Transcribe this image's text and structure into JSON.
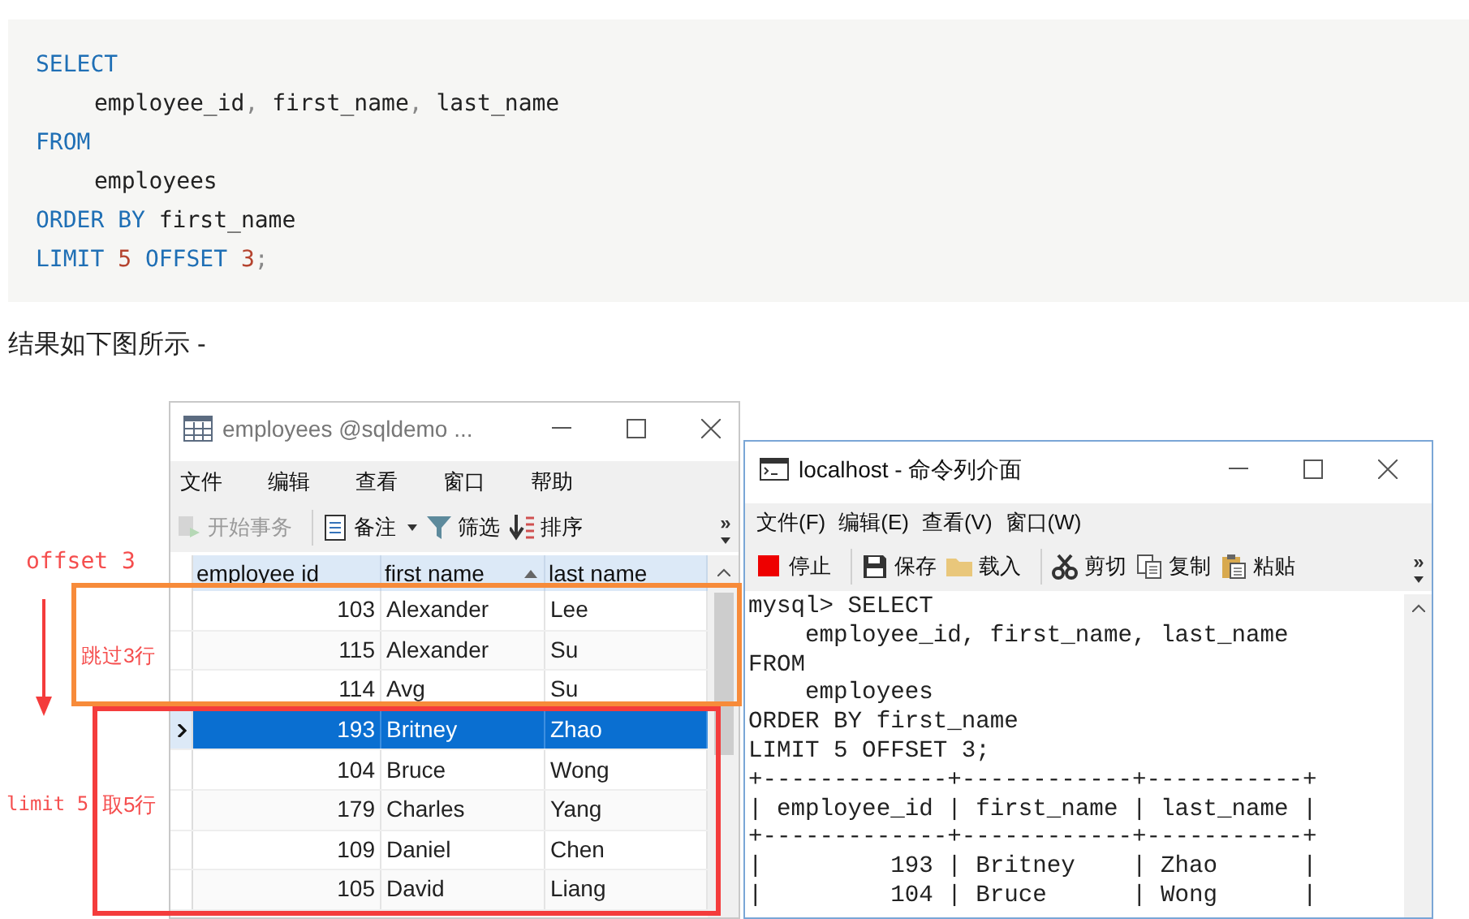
{
  "code_block": {
    "lines": [
      {
        "indent": false,
        "tokens": [
          {
            "text": "SELECT",
            "kind": "keyword"
          }
        ]
      },
      {
        "indent": true,
        "tokens": [
          {
            "text": "employee_id",
            "kind": "plain"
          },
          {
            "text": ",",
            "kind": "punct"
          },
          {
            "text": " first_name",
            "kind": "plain"
          },
          {
            "text": ",",
            "kind": "punct"
          },
          {
            "text": " last_name",
            "kind": "plain"
          }
        ]
      },
      {
        "indent": false,
        "tokens": [
          {
            "text": "FROM",
            "kind": "keyword"
          }
        ]
      },
      {
        "indent": true,
        "tokens": [
          {
            "text": "employees",
            "kind": "plain"
          }
        ]
      },
      {
        "indent": false,
        "tokens": [
          {
            "text": "ORDER BY",
            "kind": "keyword"
          },
          {
            "text": " first_name",
            "kind": "plain"
          }
        ]
      },
      {
        "indent": false,
        "tokens": [
          {
            "text": "LIMIT",
            "kind": "keyword"
          },
          {
            "text": " 5 ",
            "kind": "number"
          },
          {
            "text": "OFFSET",
            "kind": "keyword"
          },
          {
            "text": " 3",
            "kind": "number"
          },
          {
            "text": ";",
            "kind": "punct"
          }
        ]
      }
    ]
  },
  "caption": "结果如下图所示 -",
  "grid_window": {
    "title": "employees @sqldemo ...",
    "menu": [
      "文件",
      "编辑",
      "查看",
      "窗口",
      "帮助"
    ],
    "toolbar": [
      {
        "label": "开始事务",
        "disabled": true
      },
      {
        "label": "备注",
        "disabled": false
      },
      {
        "label": "筛选",
        "disabled": false
      },
      {
        "label": "排序",
        "disabled": false
      }
    ],
    "more": "»",
    "columns": [
      {
        "label": "employee id",
        "sorted": false
      },
      {
        "label": "first name",
        "sorted": true
      },
      {
        "label": "last name",
        "sorted": false
      }
    ],
    "rows": [
      {
        "cells": [
          "103",
          "Alexander",
          "Lee"
        ],
        "selected": false
      },
      {
        "cells": [
          "115",
          "Alexander",
          "Su"
        ],
        "selected": false
      },
      {
        "cells": [
          "114",
          "Avg",
          "Su"
        ],
        "selected": false
      },
      {
        "cells": [
          "193",
          "Britney",
          "Zhao"
        ],
        "selected": true
      },
      {
        "cells": [
          "104",
          "Bruce",
          "Wong"
        ],
        "selected": false
      },
      {
        "cells": [
          "179",
          "Charles",
          "Yang"
        ],
        "selected": false
      },
      {
        "cells": [
          "109",
          "Daniel",
          "Chen"
        ],
        "selected": false
      },
      {
        "cells": [
          "105",
          "David",
          "Liang"
        ],
        "selected": false
      }
    ]
  },
  "console_window": {
    "title": "localhost - 命令列介面",
    "menu": [
      "文件(F)",
      "编辑(E)",
      "查看(V)",
      "窗口(W)"
    ],
    "toolbar": [
      {
        "label": "停止"
      },
      {
        "label": "保存"
      },
      {
        "label": "载入"
      },
      {
        "label": "剪切"
      },
      {
        "label": "复制"
      },
      {
        "label": "粘贴"
      }
    ],
    "more": "»",
    "lines": [
      "mysql> SELECT",
      "    employee_id, first_name, last_name",
      "FROM",
      "    employees",
      "ORDER BY first_name",
      "LIMIT 5 OFFSET 3;",
      "+-------------+------------+-----------+",
      "| employee_id | first_name | last_name |",
      "+-------------+------------+-----------+",
      "|         193 | Britney    | Zhao      |",
      "|         104 | Bruce      | Wong      |"
    ]
  },
  "annotations": {
    "offset_label": "offset 3",
    "skip_label": "跳过3行",
    "limit_label": "limit 5",
    "take_label": "取5行"
  }
}
